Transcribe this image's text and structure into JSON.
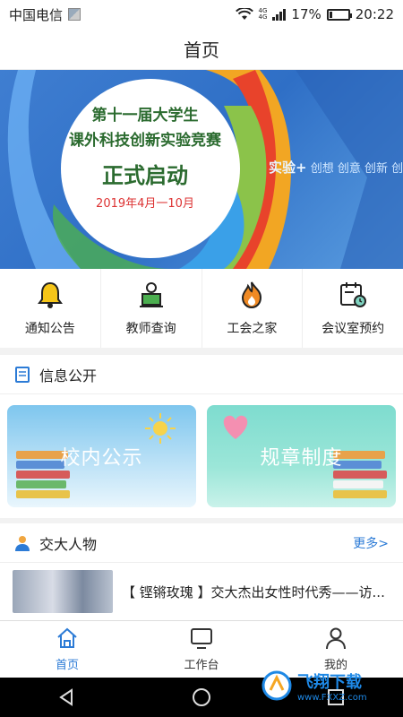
{
  "status_bar": {
    "carrier": "中国电信",
    "network_label_top": "4G",
    "network_label_bottom": "4G",
    "battery_percent": "17%",
    "battery_level": 0.17,
    "time": "20:22"
  },
  "header": {
    "title": "首页"
  },
  "banner": {
    "line1": "第十一届大学生",
    "line2": "课外科技创新实验竞赛",
    "line3": "正式启动",
    "date": "2019年4月一10月",
    "slogan_main": "实验+",
    "slogan_tail": "创想 创意 创新 创造"
  },
  "quick_menu": [
    {
      "label": "通知公告",
      "icon": "bell-icon"
    },
    {
      "label": "教师查询",
      "icon": "teacher-icon"
    },
    {
      "label": "工会之家",
      "icon": "flame-icon"
    },
    {
      "label": "会议室预约",
      "icon": "calendar-clock-icon"
    }
  ],
  "info_section": {
    "title": "信息公开",
    "icon": "book-icon",
    "cards": [
      {
        "label": "校内公示"
      },
      {
        "label": "规章制度"
      }
    ]
  },
  "people_section": {
    "title": "交大人物",
    "icon": "person-icon",
    "more": "更多>"
  },
  "article": {
    "title": "【 铿锵玫瑰 】交大杰出女性时代秀——访..."
  },
  "tabbar": [
    {
      "label": "首页",
      "icon": "home-icon",
      "active": true
    },
    {
      "label": "工作台",
      "icon": "monitor-icon",
      "active": false
    },
    {
      "label": "我的",
      "icon": "user-icon",
      "active": false
    }
  ],
  "watermark": {
    "text": "飞翔下载",
    "url": "www.FXXZ.com"
  },
  "colors": {
    "accent": "#2c7bd6",
    "banner_blue": "#3f7ed1"
  }
}
